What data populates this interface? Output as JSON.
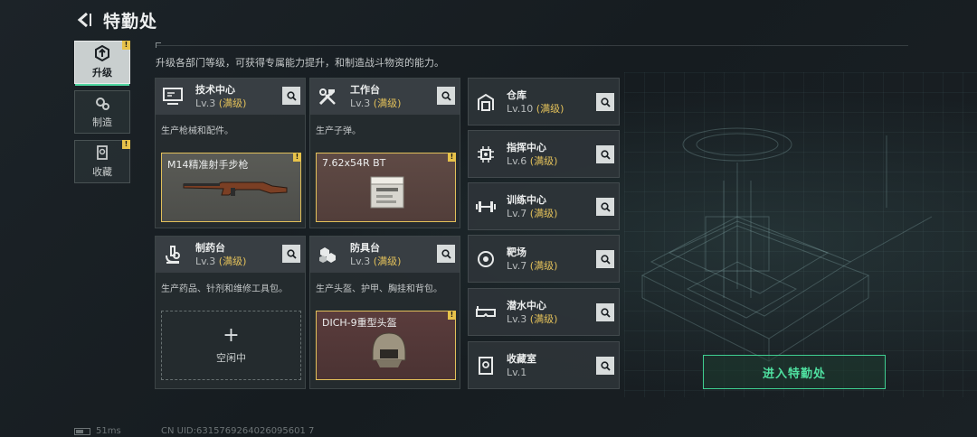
{
  "header": {
    "title": "特勤处"
  },
  "nav": [
    {
      "label": "升级",
      "icon": "upgrade-icon",
      "active": true,
      "alert": "!"
    },
    {
      "label": "制造",
      "icon": "gears-icon",
      "active": false,
      "alert": ""
    },
    {
      "label": "收藏",
      "icon": "collection-icon",
      "active": false,
      "alert": "!"
    }
  ],
  "description": "升级各部门等级，可获得专属能力提升，和制造战斗物资的能力。",
  "cards": [
    {
      "name": "技术中心",
      "level": "Lv.3",
      "max": "(满级)",
      "desc": "生产枪械和配件。",
      "slot_name": "M14精准射手步枪",
      "slot_alert": "!",
      "icon": "monitor-icon"
    },
    {
      "name": "工作台",
      "level": "Lv.3",
      "max": "(满级)",
      "desc": "生产子弹。",
      "slot_name": "7.62x54R BT",
      "slot_alert": "!",
      "icon": "tools-icon"
    },
    {
      "name": "制药台",
      "level": "Lv.3",
      "max": "(满级)",
      "desc": "生产药品、针剂和维修工具包。",
      "slot_empty_label": "空闲中",
      "slot_plus": "+",
      "icon": "microscope-icon"
    },
    {
      "name": "防具台",
      "level": "Lv.3",
      "max": "(满级)",
      "desc": "生产头盔、护甲、胸挂和背包。",
      "slot_name": "DICH-9重型头盔",
      "slot_alert": "!",
      "icon": "armor-icon"
    }
  ],
  "side_cards": [
    {
      "name": "仓库",
      "level": "Lv.10",
      "max": "(满级)",
      "icon": "warehouse-icon"
    },
    {
      "name": "指挥中心",
      "level": "Lv.6",
      "max": "(满级)",
      "icon": "chip-icon"
    },
    {
      "name": "训练中心",
      "level": "Lv.7",
      "max": "(满级)",
      "icon": "dumbbell-icon"
    },
    {
      "name": "靶场",
      "level": "Lv.7",
      "max": "(满级)",
      "icon": "target-icon"
    },
    {
      "name": "潜水中心",
      "level": "Lv.3",
      "max": "(满级)",
      "icon": "diving-mask-icon"
    },
    {
      "name": "收藏室",
      "level": "Lv.1",
      "max": "",
      "icon": "collection-room-icon"
    }
  ],
  "enter_button": "进入特勤处",
  "footer": {
    "ping": "51ms",
    "uid": "CN UID:6315769264026095601 7"
  },
  "colors": {
    "accent_green": "#4fe0a0",
    "max_gold": "#e2c05a",
    "alert_yellow": "#e7c24a"
  }
}
